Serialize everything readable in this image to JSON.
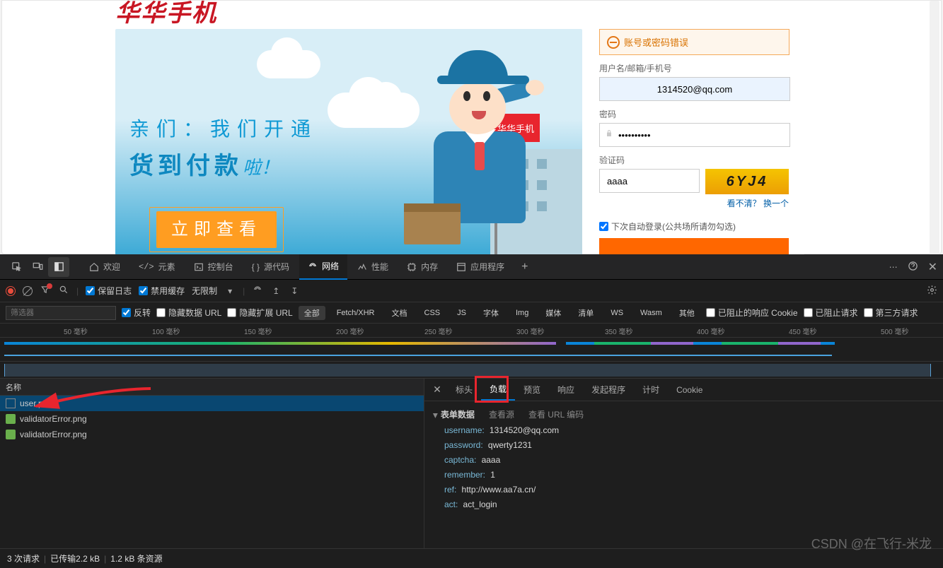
{
  "site": {
    "logo": "华华手机",
    "banner": {
      "line1": "亲们：我们开通",
      "line2_bold": "货到付款",
      "line2_tail": "啦！",
      "button": "立即查看",
      "flag_text": "华华手机"
    },
    "login": {
      "error": "账号或密码错误",
      "label_user": "用户名/邮箱/手机号",
      "value_user": "1314520@qq.com",
      "label_pw": "密码",
      "value_pw": "••••••••••",
      "label_captcha": "验证码",
      "value_captcha": "aaaa",
      "captcha_img": "6YJ4",
      "captcha_hint": "看不清？",
      "captcha_change": "换一个",
      "remember": "下次自动登录(公共场所请勿勾选)"
    }
  },
  "devtools": {
    "tabs": {
      "welcome": "欢迎",
      "elements": "元素",
      "console": "控制台",
      "sources": "源代码",
      "network": "网络",
      "performance": "性能",
      "memory": "内存",
      "application": "应用程序"
    },
    "toolbar": {
      "preserve_log": "保留日志",
      "disable_cache": "禁用缓存",
      "throttling": "无限制"
    },
    "filter": {
      "placeholder": "筛选器",
      "invert": "反转",
      "hide_data": "隐藏数据 URL",
      "hide_ext": "隐藏扩展 URL",
      "all": "全部",
      "fetch": "Fetch/XHR",
      "doc": "文档",
      "css": "CSS",
      "js": "JS",
      "font": "字体",
      "img": "Img",
      "media": "媒体",
      "manifest": "清单",
      "ws": "WS",
      "wasm": "Wasm",
      "other": "其他",
      "blocked_cookies": "已阻止的响应 Cookie",
      "blocked_req": "已阻止请求",
      "third_party": "第三方请求"
    },
    "ruler": [
      "50 毫秒",
      "100 毫秒",
      "150 毫秒",
      "200 毫秒",
      "250 毫秒",
      "300 毫秒",
      "350 毫秒",
      "400 毫秒",
      "450 毫秒",
      "500 毫秒"
    ],
    "requests": {
      "header": "名称",
      "rows": [
        "user.php",
        "validatorError.png",
        "validatorError.png"
      ]
    },
    "detail": {
      "tabs": {
        "headers": "标头",
        "payload": "负载",
        "preview": "预览",
        "response": "响应",
        "initiator": "发起程序",
        "timing": "计时",
        "cookies": "Cookie"
      },
      "section_title": "表单数据",
      "view_source": "查看源",
      "view_url": "查看 URL 编码",
      "form": {
        "username_k": "username:",
        "username_v": "1314520@qq.com",
        "password_k": "password:",
        "password_v": "qwerty1231",
        "captcha_k": "captcha:",
        "captcha_v": "aaaa",
        "remember_k": "remember:",
        "remember_v": "1",
        "ref_k": "ref:",
        "ref_v": "http://www.aa7a.cn/",
        "act_k": "act:",
        "act_v": "act_login"
      }
    },
    "status": {
      "requests": "3 次请求",
      "transferred": "已传输2.2 kB",
      "resources": "1.2 kB 条资源"
    }
  },
  "watermark": "CSDN @在飞行-米龙"
}
